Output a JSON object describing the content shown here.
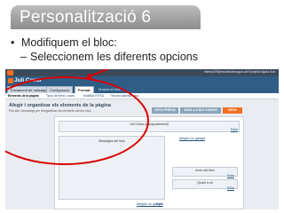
{
  "slide": {
    "title": "Personalització  6",
    "bullet": "Modifiquem el bloc:",
    "subbullet": "Seleccionem les diferents opcions",
    "bullet_mark": "•",
    "sub_mark": "–"
  },
  "screenshot": {
    "topbar_links": "mlernud79@escolesdernogue.cat  Escriptori  Ajuda  Surt",
    "blog_name": "Juli Cesar",
    "tabs": [
      "Enviament de missatges",
      "Configuració",
      "Format",
      "Mostra el bloc"
    ],
    "active_tab": "Format",
    "subtabs": [
      "Elements de la pàgina",
      "Tipus de lletra i colors",
      "Modifica l'HTML",
      "Tria una plantilla nova"
    ],
    "heading": "Afegir i organitzar els elements de la pàgina",
    "description": "Fes clic i arrossega per reorganitzar els elements del teu bloc.",
    "buttons": {
      "preview": "VISTA PRÈVIA",
      "clear": "ANUL·LA ELS CANVIS",
      "save": "DESA"
    },
    "layout": {
      "header_box": "Juli César (encapçalament)",
      "posts_box": "Missatges del bloc",
      "add_gadget_top": "Afegeix un gadget",
      "archive_box": "Arxiu del bloc",
      "about_box": "Quant a mi",
      "add_gadget_bottom": "Afegeix un gadget",
      "edit": "Edita"
    }
  },
  "colors": {
    "annotation": "#d90000",
    "blogger_orange": "#f37021",
    "blogger_blue": "#2f5d86"
  }
}
